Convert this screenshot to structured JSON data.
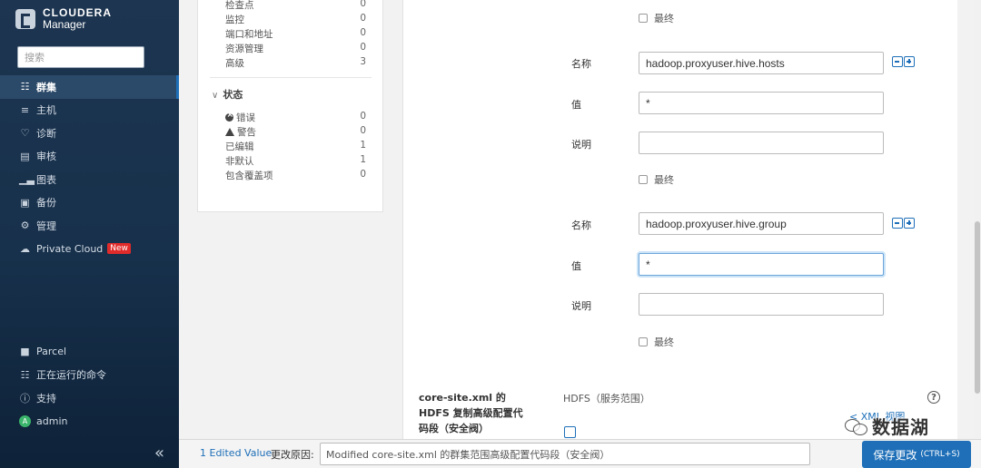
{
  "sidebar": {
    "brand_line1": "CLOUDERA",
    "brand_line2": "Manager",
    "search_placeholder": "搜索",
    "nav": [
      {
        "label": "群集",
        "icon": "clusters-icon",
        "active": true
      },
      {
        "label": "主机",
        "icon": "hosts-icon"
      },
      {
        "label": "诊断",
        "icon": "diagnostics-icon"
      },
      {
        "label": "审核",
        "icon": "audit-icon"
      },
      {
        "label": "图表",
        "icon": "charts-icon"
      },
      {
        "label": "备份",
        "icon": "backup-icon"
      },
      {
        "label": "管理",
        "icon": "gear-icon"
      },
      {
        "label": "Private Cloud",
        "icon": "cloud-icon",
        "badge": "New"
      }
    ],
    "bottom_nav": [
      {
        "label": "Parcel",
        "icon": "parcel-icon"
      },
      {
        "label": "正在运行的命令",
        "icon": "commands-icon"
      },
      {
        "label": "支持",
        "icon": "help-icon"
      },
      {
        "label": "admin",
        "icon": "avatar-icon",
        "avatar_letter": "A"
      }
    ],
    "collapse_glyph": "«"
  },
  "filters": {
    "categories": [
      {
        "label": "检查点",
        "count": "0"
      },
      {
        "label": "监控",
        "count": "0"
      },
      {
        "label": "端口和地址",
        "count": "0"
      },
      {
        "label": "资源管理",
        "count": "0"
      },
      {
        "label": "高级",
        "count": "3"
      }
    ],
    "status_header": "状态",
    "status": [
      {
        "label": "错误",
        "count": "0",
        "icon": "error-icon"
      },
      {
        "label": "警告",
        "count": "0",
        "icon": "warning-icon"
      },
      {
        "label": "已编辑",
        "count": "1"
      },
      {
        "label": "非默认",
        "count": "1"
      },
      {
        "label": "包含覆盖项",
        "count": "0"
      }
    ]
  },
  "main": {
    "labels": {
      "name": "名称",
      "value": "值",
      "desc": "说明",
      "final": "最终"
    },
    "properties": [
      {
        "name": "hadoop.proxyuser.hive.hosts",
        "value": "*",
        "description": ""
      },
      {
        "name": "hadoop.proxyuser.hive.group",
        "value": "*",
        "description": ""
      }
    ],
    "section_title": "core-site.xml 的 HDFS 复制高级配置代码段（安全阀）",
    "section_scope": "HDFS（服务范围）",
    "xml_link": "< XML 视图",
    "help_glyph": "?"
  },
  "watermark": "数据湖",
  "bottom_bar": {
    "edited_value": "1 Edited Value",
    "reason_label": "更改原因:",
    "reason_value": "Modified core-site.xml 的群集范围高级配置代码段（安全阀）",
    "save_label": "保存更改",
    "save_shortcut": "(CTRL+S)"
  },
  "colors": {
    "sidebar_bg": "#1d3550",
    "accent": "#1e6fb8",
    "badge": "#e02b2b"
  }
}
